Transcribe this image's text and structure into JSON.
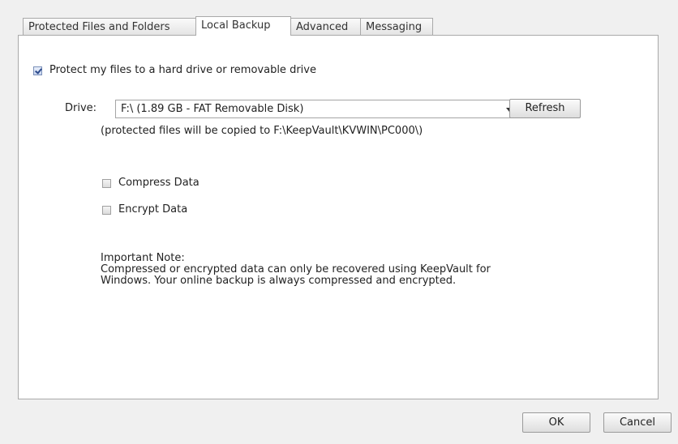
{
  "tabs": [
    {
      "label": "Protected Files and Folders"
    },
    {
      "label": "Local Backup"
    },
    {
      "label": "Advanced"
    },
    {
      "label": "Messaging"
    }
  ],
  "local_backup": {
    "protect_label": "Protect my files to a hard drive or removable drive",
    "protect_checked": true,
    "drive_label": "Drive:",
    "drive_value": "F:\\ (1.89 GB - FAT Removable Disk)",
    "refresh_label": "Refresh",
    "copy_note": "(protected files will be copied to F:\\KeepVault\\KVWIN\\PC000\\)",
    "compress_label": "Compress Data",
    "compress_checked": false,
    "encrypt_label": "Encrypt Data",
    "encrypt_checked": false,
    "note_heading": "Important Note:",
    "note_line1": "Compressed or encrypted data can only be recovered using KeepVault for",
    "note_line2": "Windows. Your online backup is always compressed and encrypted."
  },
  "footer": {
    "ok_label": "OK",
    "cancel_label": "Cancel"
  }
}
